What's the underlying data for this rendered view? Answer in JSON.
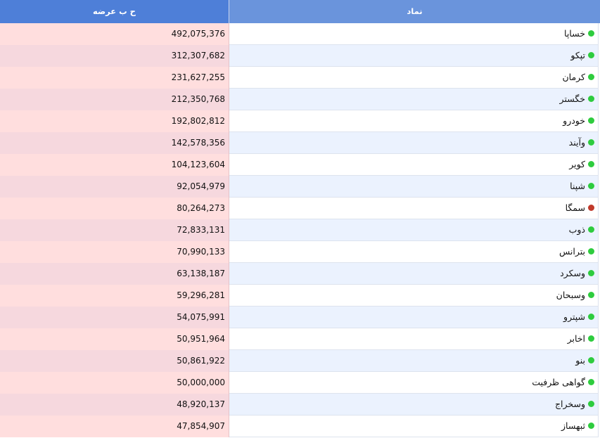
{
  "header": {
    "symbol_label": "نماد",
    "value_label": "ح ب عرضه"
  },
  "colors": {
    "up": "#2ecc3e",
    "down": "#c0392b"
  },
  "rows": [
    {
      "symbol": "خساپا",
      "value": "492,075,376",
      "status": "up"
    },
    {
      "symbol": "تپکو",
      "value": "312,307,682",
      "status": "up"
    },
    {
      "symbol": "کرمان",
      "value": "231,627,255",
      "status": "up"
    },
    {
      "symbol": "خگستر",
      "value": "212,350,768",
      "status": "up"
    },
    {
      "symbol": "خودرو",
      "value": "192,802,812",
      "status": "up"
    },
    {
      "symbol": "وآیند",
      "value": "142,578,356",
      "status": "up"
    },
    {
      "symbol": "کویر",
      "value": "104,123,604",
      "status": "up"
    },
    {
      "symbol": "شپنا",
      "value": "92,054,979",
      "status": "up"
    },
    {
      "symbol": "سمگا",
      "value": "80,264,273",
      "status": "down"
    },
    {
      "symbol": "ذوب",
      "value": "72,833,131",
      "status": "up"
    },
    {
      "symbol": "بترانس",
      "value": "70,990,133",
      "status": "up"
    },
    {
      "symbol": "وسکرد",
      "value": "63,138,187",
      "status": "up"
    },
    {
      "symbol": "وسبحان",
      "value": "59,296,281",
      "status": "up"
    },
    {
      "symbol": "شپترو",
      "value": "54,075,991",
      "status": "up"
    },
    {
      "symbol": "اخابر",
      "value": "50,951,964",
      "status": "up"
    },
    {
      "symbol": "بنو",
      "value": "50,861,922",
      "status": "up"
    },
    {
      "symbol": "گواهی ظرفیت",
      "value": "50,000,000",
      "status": "up"
    },
    {
      "symbol": "وسخراج",
      "value": "48,920,137",
      "status": "up"
    },
    {
      "symbol": "ثبهساز",
      "value": "47,854,907",
      "status": "up"
    }
  ]
}
